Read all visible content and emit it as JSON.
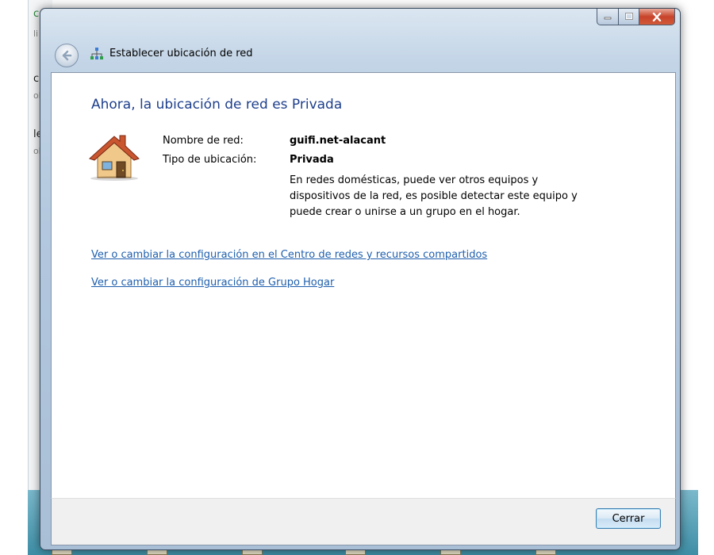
{
  "background": {
    "left_fragments": [
      "co",
      "li",
      "c",
      "oli",
      "le",
      "oli"
    ]
  },
  "window": {
    "title": "Establecer ubicación de red",
    "caption_buttons": {
      "minimize": "minimize-icon",
      "maximize": "maximize-icon",
      "close": "close-icon"
    }
  },
  "main": {
    "heading": "Ahora, la ubicación de red es Privada",
    "icon": "home-network-icon",
    "network_name_label": "Nombre de red:",
    "network_name_value": "guifi.net-alacant",
    "location_type_label": "Tipo de ubicación:",
    "location_type_value": "Privada",
    "description": "En redes domésticas, puede ver otros equipos y dispositivos de la red, es posible detectar este equipo y puede crear o unirse a un grupo en el hogar.",
    "links": [
      "Ver o cambiar la configuración en el Centro de redes y recursos compartidos",
      "Ver o cambiar la configuración de Grupo Hogar"
    ]
  },
  "footer": {
    "close_label": "Cerrar"
  },
  "colors": {
    "heading": "#1e3f8c",
    "link": "#1f5fad",
    "close_button": "#c7442a"
  }
}
